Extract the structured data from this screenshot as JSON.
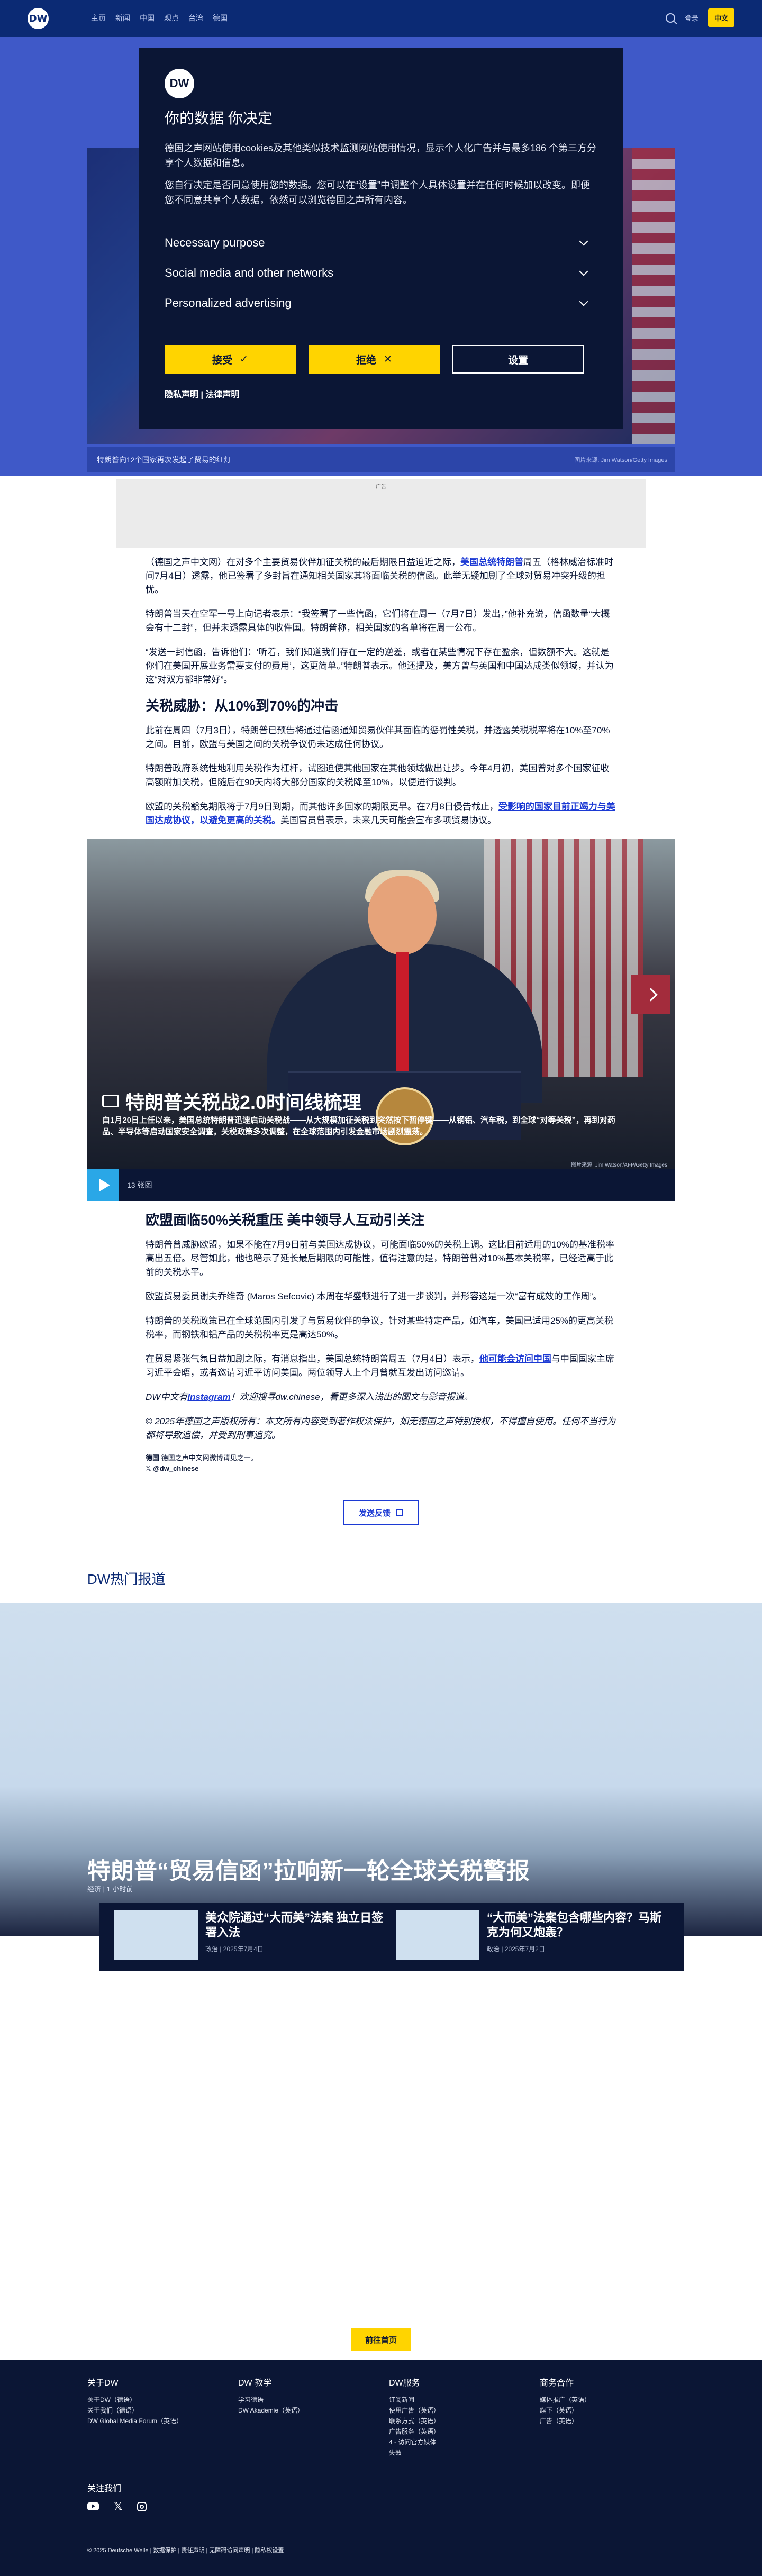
{
  "nav": {
    "logo": "DW",
    "items": [
      "主页",
      "新闻",
      "中国",
      "观点",
      "台湾",
      "德国"
    ],
    "search_label": "搜索",
    "lang": "中文",
    "login": "登录"
  },
  "cookie": {
    "logo": "DW",
    "title": "你的数据 你决定",
    "p1": "德国之声网站使用cookies及其他类似技术监测网站使用情况，显示个人化广告并与最多186 个第三方分享个人数据和信息。",
    "p2": "您自行决定是否同意使用您的数据。您可以在“设置”中调整个人具体设置并在任何时候加以改变。即便您不同意共享个人数据，依然可以浏览德国之声所有内容。",
    "sections": [
      "Necessary purpose",
      "Social media and other networks",
      "Personalized advertising"
    ],
    "accept": "接受",
    "reject": "拒绝",
    "settings": "设置",
    "links": "隐私声明 | 法律声明"
  },
  "hero": {
    "caption": "特朗普向12个国家再次发起了贸易的红灯",
    "credit": "图片来源: Jim Watson/Getty Images"
  },
  "ad": {
    "label": "广告"
  },
  "article": {
    "p1a": "（德国之声中文网）在对多个主要贸易伙伴加征关税的最后期限日益迫近之际，",
    "p1link": "美国总统特朗普",
    "p1b": "周五（格林威治标准时间7月4日）透露，他已签署了多封旨在通知相关国家其将面临关税的信函。此举无疑加剧了全球对贸易冲突升级的担忧。",
    "p2": "特朗普当天在空军一号上向记者表示：“我签署了一些信函，它们将在周一（7月7日）发出，”他补充说，信函数量“大概会有十二封”，但并未透露具体的收件国。特朗普称，相关国家的名单将在周一公布。",
    "p3": "“发送一封信函，告诉他们：‘听着，我们知道我们存在一定的逆差，或者在某些情况下存在盈余，但数额不大。这就是你们在美国开展业务需要支付的费用’，这更简单。”特朗普表示。他还提及，美方曾与英国和中国达成类似领域，并认为这“对双方都非常好”。",
    "h1": "关税威胁：从10%到70%的冲击",
    "p4": "此前在周四（7月3日），特朗普已预告将通过信函通知贸易伙伴其面临的惩罚性关税，并透露关税税率将在10%至70%之间。目前，欧盟与美国之间的关税争议仍未达成任何协议。",
    "p5": "特朗普政府系统性地利用关税作为杠杆，试图迫使其他国家在其他领域做出让步。今年4月初，美国曾对多个国家征收高额附加关税，但随后在90天内将大部分国家的关税降至10%，以便进行谈判。",
    "p6a": "欧盟的关税豁免期限将于7月9日到期，而其他许多国家的期限更早。在7月8日侵告截止，",
    "p6link": "受影响的国家目前正竭力与美国达成协议，以避免更高的关税。",
    "p6b": "美国官员曾表示，未来几天可能会宣布多项贸易协议。",
    "h2": "欧盟面临50%关税重压 美中领导人互动引关注",
    "p7": "特朗普曾威胁欧盟，如果不能在7月9日前与美国达成协议，可能面临50%的关税上调。这比目前适用的10%的基准税率高出五倍。尽管如此，他也暗示了延长最后期限的可能性，值得注意的是，特朗普曾对10%基本关税率，已经适高于此前的关税水平。",
    "p8": "欧盟贸易委员谢夫乔维奇 (Maros Sefcovic) 本周在华盛顿进行了进一步谈判，并形容这是一次“富有成效的工作周”。",
    "p9": "特朗普的关税政策已在全球范围内引发了与贸易伙伴的争议，针对某些特定产品，如汽车，美国已适用25%的更高关税税率，而钢铁和铝产品的关税税率更是高达50%。",
    "p10a": "在贸易紧张气氛日益加剧之际，有消息指出，美国总统特朗普周五（7月4日）表示，",
    "p10link": "他可能会访问中国",
    "p10b": "与中国国家主席习近平会晤，或者邀请习近平访问美国。两位领导人上个月曾就互发出访问邀请。",
    "p11a": "DW中文有",
    "p11link": "Instagram",
    "p11b": "！欢迎搜寻dw.chinese，看更多深入浅出的图文与影音报道。",
    "copyright": "© 2025年德国之声版权所有：本文所有内容受到著作权法保护，如无德国之声特别授权，不得擅自使用。任何不当行为都将导致追偿，并受到刑事追究。",
    "follow_tag": "德国",
    "follow_text": "德国之声中文网微博请见之一。",
    "follow_x": "@dw_chinese",
    "share": "发送反馈"
  },
  "gallery": {
    "title": "特朗普关税战2.0时间线梳理",
    "subtitle": "自1月20日上任以来，美国总统特朗普迅速启动关税战——从大规模加征关税到突然按下暂停键——从钢铝、汽车税，到全球“对等关税”，再到对药品、半导体等启动国家安全调查，关税政策多次调整，在全球范围内引发金融市场剧烈震荡。",
    "credit": "图片来源: Jim Watson/AFP/Getty Images",
    "count": "13 张图"
  },
  "popular": {
    "heading": "DW热门报道",
    "title": "特朗普“贸易信函”拉响新一轮全球关税警报",
    "meta": "经济 | 1 小时前",
    "cards": [
      {
        "title": "美众院通过“大而美”法案 独立日签署入法",
        "meta": "政治 | 2025年7月4日"
      },
      {
        "title": "“大而美”法案包含哪些内容？马斯克为何又炮轰？",
        "meta": "政治 | 2025年7月2日"
      }
    ]
  },
  "home_button": "前往首页",
  "footer": {
    "col1": {
      "head": "关于DW",
      "items": [
        "关于DW（德语）",
        "关于我们（德语）",
        "DW Global Media Forum（英语）"
      ]
    },
    "col2": {
      "head": "DW 教学",
      "items": [
        "学习德语",
        "DW Akademie（英语）"
      ]
    },
    "col3": {
      "head": "DW服务",
      "items": [
        "订阅新闻",
        "使用广告（英语）",
        "联系方式（英语）",
        "广告服务（英语）",
        "4 - 访问官方媒体",
        "失效"
      ]
    },
    "col4": {
      "head": "商务合作",
      "items": [
        "媒体推广（英语）",
        "旗下（英语）",
        "广告（英语）"
      ]
    },
    "follow_us": "关注我们",
    "bottom": "© 2025 Deutsche Welle | 数据保护 | 责任声明 | 无障碍访问声明 | 隐私权设置"
  },
  "colors": {
    "brand": "#0b2a74",
    "accent": "#ffd400",
    "link": "#1c3ad4",
    "overlay": "#3f59c8"
  }
}
